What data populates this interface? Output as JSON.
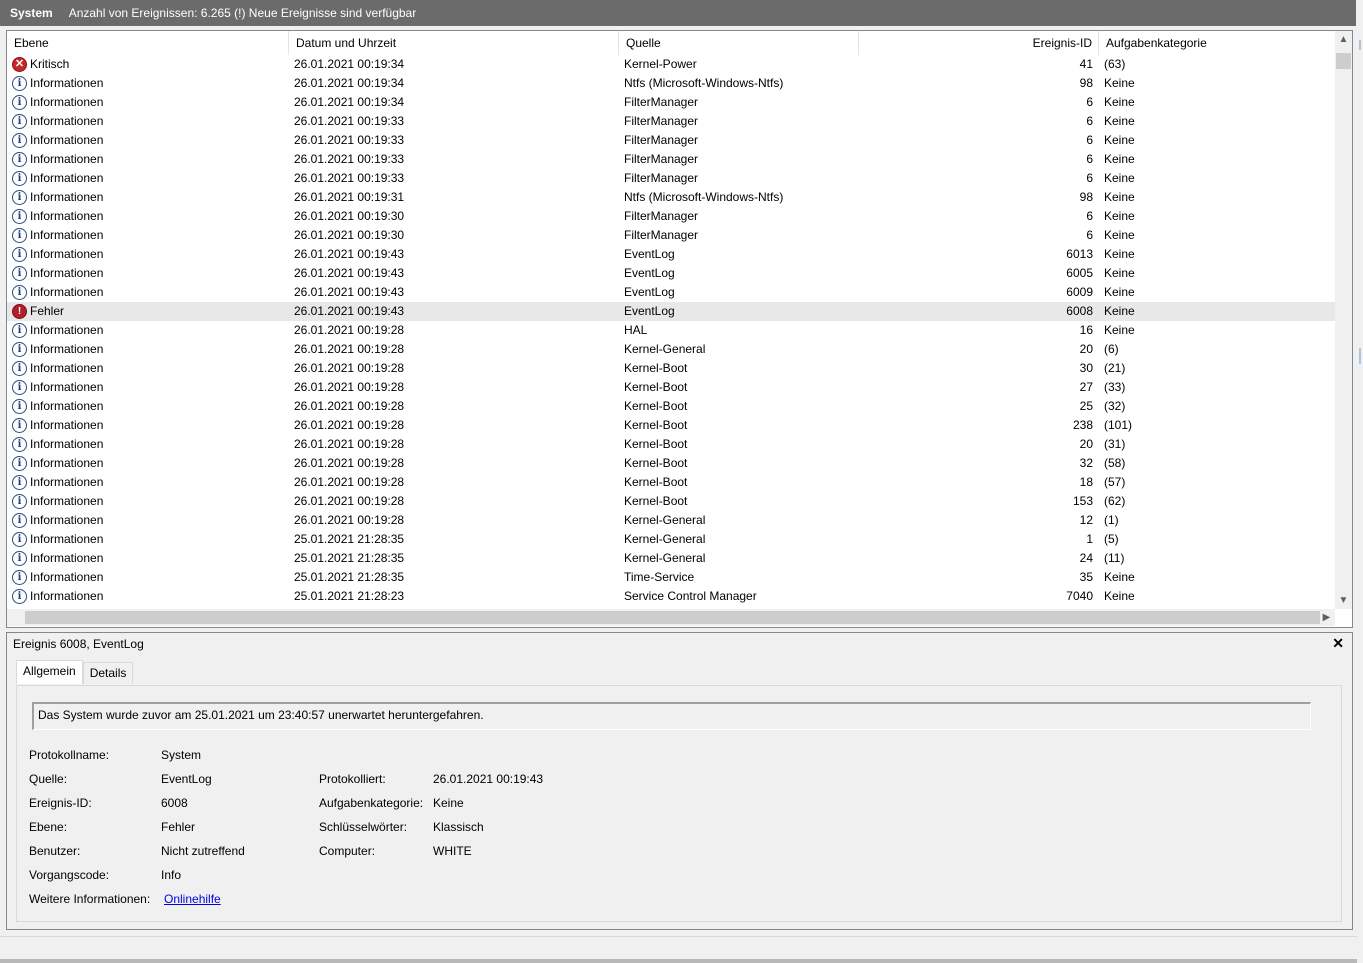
{
  "window": {
    "log_name": "System",
    "info": "Anzahl von Ereignissen: 6.265 (!) Neue Ereignisse sind verfügbar"
  },
  "columns": {
    "level": "Ebene",
    "datetime": "Datum und Uhrzeit",
    "source": "Quelle",
    "event_id": "Ereignis-ID",
    "task_category": "Aufgabenkategorie"
  },
  "rows": [
    {
      "level": "Kritisch",
      "icon": "critical-icon",
      "datetime": "26.01.2021 00:19:34",
      "source": "Kernel-Power",
      "event_id": "41",
      "task": "(63)"
    },
    {
      "level": "Informationen",
      "icon": "info-icon",
      "datetime": "26.01.2021 00:19:34",
      "source": "Ntfs (Microsoft-Windows-Ntfs)",
      "event_id": "98",
      "task": "Keine"
    },
    {
      "level": "Informationen",
      "icon": "info-icon",
      "datetime": "26.01.2021 00:19:34",
      "source": "FilterManager",
      "event_id": "6",
      "task": "Keine"
    },
    {
      "level": "Informationen",
      "icon": "info-icon",
      "datetime": "26.01.2021 00:19:33",
      "source": "FilterManager",
      "event_id": "6",
      "task": "Keine"
    },
    {
      "level": "Informationen",
      "icon": "info-icon",
      "datetime": "26.01.2021 00:19:33",
      "source": "FilterManager",
      "event_id": "6",
      "task": "Keine"
    },
    {
      "level": "Informationen",
      "icon": "info-icon",
      "datetime": "26.01.2021 00:19:33",
      "source": "FilterManager",
      "event_id": "6",
      "task": "Keine"
    },
    {
      "level": "Informationen",
      "icon": "info-icon",
      "datetime": "26.01.2021 00:19:33",
      "source": "FilterManager",
      "event_id": "6",
      "task": "Keine"
    },
    {
      "level": "Informationen",
      "icon": "info-icon",
      "datetime": "26.01.2021 00:19:31",
      "source": "Ntfs (Microsoft-Windows-Ntfs)",
      "event_id": "98",
      "task": "Keine"
    },
    {
      "level": "Informationen",
      "icon": "info-icon",
      "datetime": "26.01.2021 00:19:30",
      "source": "FilterManager",
      "event_id": "6",
      "task": "Keine"
    },
    {
      "level": "Informationen",
      "icon": "info-icon",
      "datetime": "26.01.2021 00:19:30",
      "source": "FilterManager",
      "event_id": "6",
      "task": "Keine"
    },
    {
      "level": "Informationen",
      "icon": "info-icon",
      "datetime": "26.01.2021 00:19:43",
      "source": "EventLog",
      "event_id": "6013",
      "task": "Keine"
    },
    {
      "level": "Informationen",
      "icon": "info-icon",
      "datetime": "26.01.2021 00:19:43",
      "source": "EventLog",
      "event_id": "6005",
      "task": "Keine"
    },
    {
      "level": "Informationen",
      "icon": "info-icon",
      "datetime": "26.01.2021 00:19:43",
      "source": "EventLog",
      "event_id": "6009",
      "task": "Keine"
    },
    {
      "level": "Fehler",
      "icon": "error-icon",
      "datetime": "26.01.2021 00:19:43",
      "source": "EventLog",
      "event_id": "6008",
      "task": "Keine",
      "selected": true
    },
    {
      "level": "Informationen",
      "icon": "info-icon",
      "datetime": "26.01.2021 00:19:28",
      "source": "HAL",
      "event_id": "16",
      "task": "Keine"
    },
    {
      "level": "Informationen",
      "icon": "info-icon",
      "datetime": "26.01.2021 00:19:28",
      "source": "Kernel-General",
      "event_id": "20",
      "task": "(6)"
    },
    {
      "level": "Informationen",
      "icon": "info-icon",
      "datetime": "26.01.2021 00:19:28",
      "source": "Kernel-Boot",
      "event_id": "30",
      "task": "(21)"
    },
    {
      "level": "Informationen",
      "icon": "info-icon",
      "datetime": "26.01.2021 00:19:28",
      "source": "Kernel-Boot",
      "event_id": "27",
      "task": "(33)"
    },
    {
      "level": "Informationen",
      "icon": "info-icon",
      "datetime": "26.01.2021 00:19:28",
      "source": "Kernel-Boot",
      "event_id": "25",
      "task": "(32)"
    },
    {
      "level": "Informationen",
      "icon": "info-icon",
      "datetime": "26.01.2021 00:19:28",
      "source": "Kernel-Boot",
      "event_id": "238",
      "task": "(101)"
    },
    {
      "level": "Informationen",
      "icon": "info-icon",
      "datetime": "26.01.2021 00:19:28",
      "source": "Kernel-Boot",
      "event_id": "20",
      "task": "(31)"
    },
    {
      "level": "Informationen",
      "icon": "info-icon",
      "datetime": "26.01.2021 00:19:28",
      "source": "Kernel-Boot",
      "event_id": "32",
      "task": "(58)"
    },
    {
      "level": "Informationen",
      "icon": "info-icon",
      "datetime": "26.01.2021 00:19:28",
      "source": "Kernel-Boot",
      "event_id": "18",
      "task": "(57)"
    },
    {
      "level": "Informationen",
      "icon": "info-icon",
      "datetime": "26.01.2021 00:19:28",
      "source": "Kernel-Boot",
      "event_id": "153",
      "task": "(62)"
    },
    {
      "level": "Informationen",
      "icon": "info-icon",
      "datetime": "26.01.2021 00:19:28",
      "source": "Kernel-General",
      "event_id": "12",
      "task": "(1)"
    },
    {
      "level": "Informationen",
      "icon": "info-icon",
      "datetime": "25.01.2021 21:28:35",
      "source": "Kernel-General",
      "event_id": "1",
      "task": "(5)"
    },
    {
      "level": "Informationen",
      "icon": "info-icon",
      "datetime": "25.01.2021 21:28:35",
      "source": "Kernel-General",
      "event_id": "24",
      "task": "(11)"
    },
    {
      "level": "Informationen",
      "icon": "info-icon",
      "datetime": "25.01.2021 21:28:35",
      "source": "Time-Service",
      "event_id": "35",
      "task": "Keine"
    },
    {
      "level": "Informationen",
      "icon": "info-icon",
      "datetime": "25.01.2021 21:28:23",
      "source": "Service Control Manager",
      "event_id": "7040",
      "task": "Keine"
    }
  ],
  "detail": {
    "title": "Ereignis 6008, EventLog",
    "tabs": [
      "Allgemein",
      "Details"
    ],
    "message": "Das System wurde zuvor am 25.01.2021 um 23:40:57 unerwartet heruntergefahren.",
    "labels": {
      "log_name": "Protokollname:",
      "source": "Quelle:",
      "event_id": "Ereignis-ID:",
      "level": "Ebene:",
      "user": "Benutzer:",
      "opcode": "Vorgangscode:",
      "more_info": "Weitere Informationen:",
      "logged": "Protokolliert:",
      "task_category": "Aufgabenkategorie:",
      "keywords": "Schlüsselwörter:",
      "computer": "Computer:"
    },
    "values": {
      "log_name": "System",
      "source": "EventLog",
      "event_id": "6008",
      "level": "Fehler",
      "user": "Nicht zutreffend",
      "opcode": "Info",
      "more_info_link": "Onlinehilfe",
      "logged": "26.01.2021 00:19:43",
      "task_category": "Keine",
      "keywords": "Klassisch",
      "computer": "WHITE"
    }
  }
}
